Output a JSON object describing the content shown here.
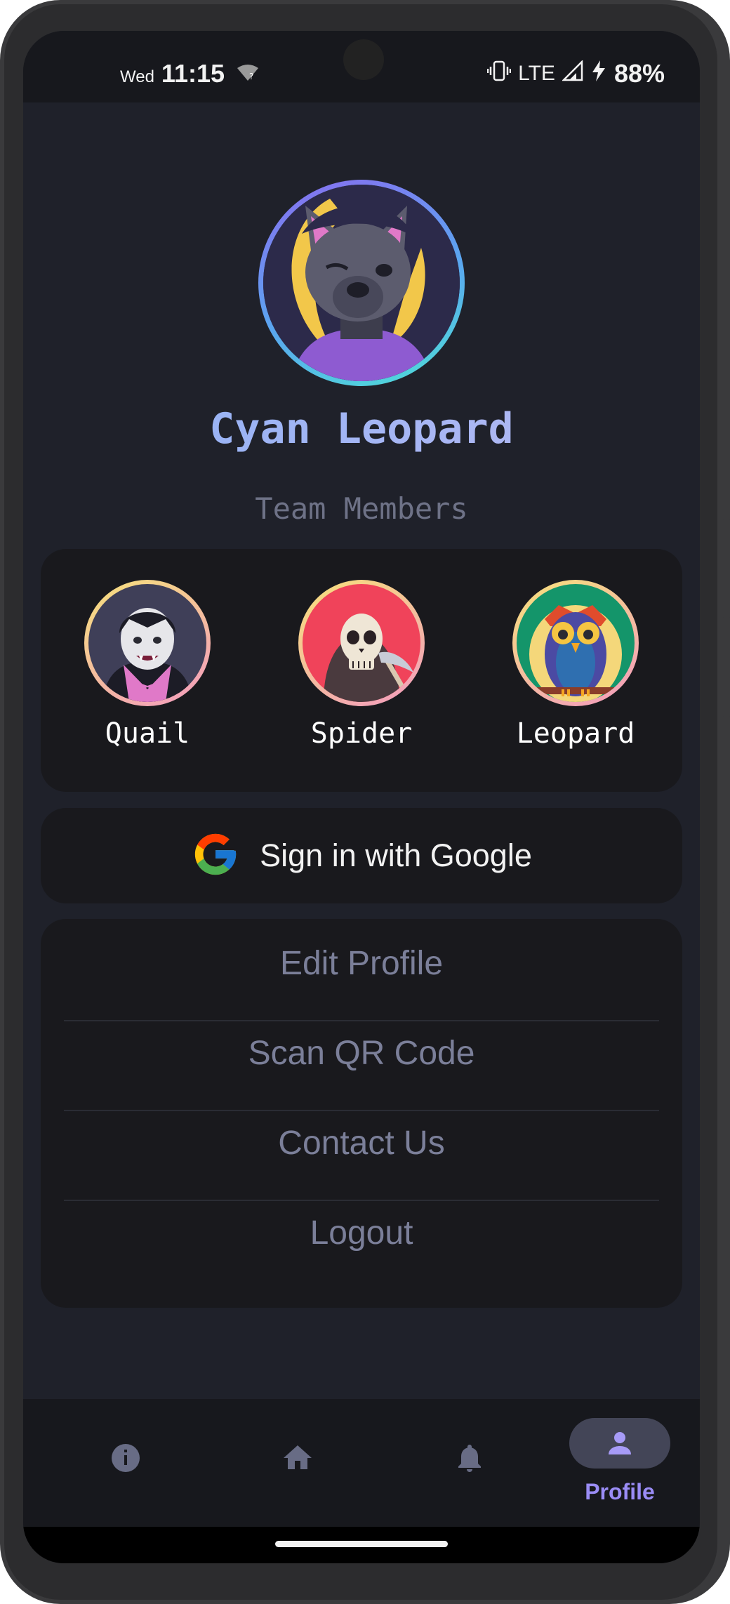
{
  "statusbar": {
    "day": "Wed",
    "time": "11:15",
    "network": "LTE",
    "battery": "88%",
    "icons": [
      "wifi-unknown-icon",
      "vibrate-icon",
      "signal-icon",
      "charging-icon"
    ]
  },
  "profile": {
    "name": "Cyan Leopard",
    "avatar_icon": "wolf-avatar-icon"
  },
  "team": {
    "title": "Team Members",
    "members": [
      {
        "name": "Quail",
        "avatar_icon": "vampire-avatar-icon"
      },
      {
        "name": "Spider",
        "avatar_icon": "skeleton-reaper-avatar-icon"
      },
      {
        "name": "Leopard",
        "avatar_icon": "owl-avatar-icon"
      }
    ]
  },
  "google": {
    "label": "Sign in with Google",
    "icon": "google-g-icon"
  },
  "menu": {
    "items": [
      "Edit Profile",
      "Scan QR Code",
      "Contact Us",
      "Logout"
    ]
  },
  "bottom_nav": {
    "items": [
      {
        "icon": "info-icon",
        "label": ""
      },
      {
        "icon": "home-icon",
        "label": ""
      },
      {
        "icon": "bell-icon",
        "label": ""
      },
      {
        "icon": "person-icon",
        "label": "Profile",
        "active": true
      }
    ]
  },
  "colors": {
    "background": "#1f212a",
    "card": "#19191d",
    "accent": "#9a8cf5",
    "name_gradient_start": "#8fb2f6",
    "muted_text": "#7b7f99"
  }
}
